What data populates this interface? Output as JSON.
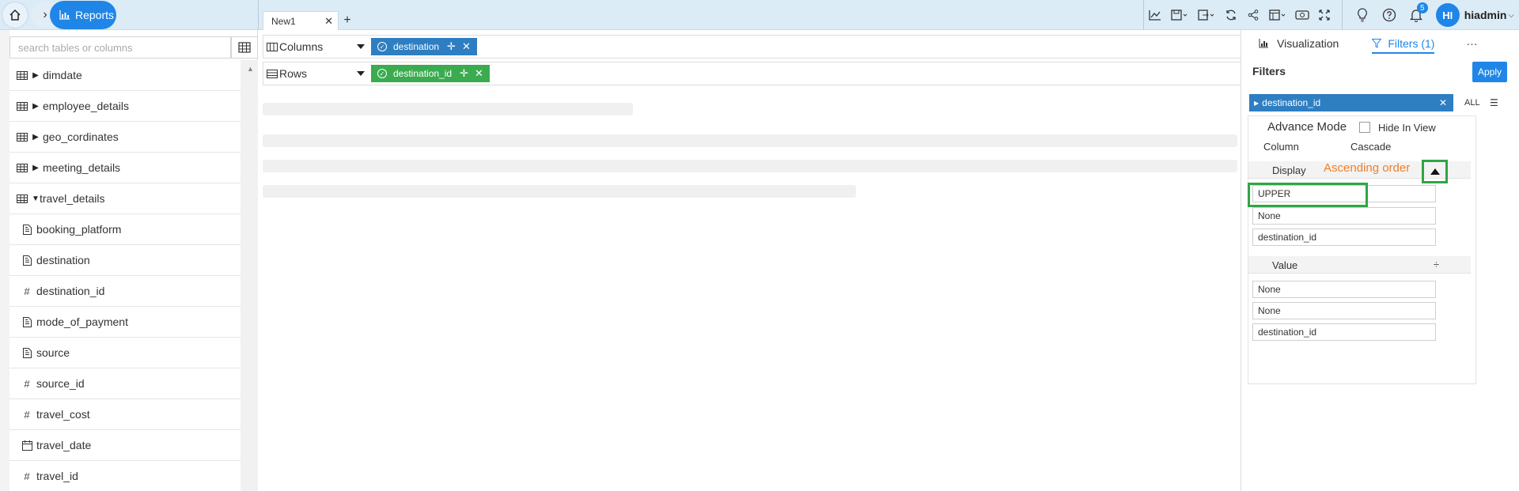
{
  "topbar": {
    "breadcrumb_label": "Reports",
    "tabs": [
      {
        "label": "New1"
      }
    ],
    "add_tab": "+",
    "notification_count": "5",
    "user": {
      "initials": "HI",
      "name": "hiadmin"
    }
  },
  "left": {
    "search_placeholder": "search tables or columns",
    "items": [
      {
        "type": "table",
        "label": "dimdate",
        "expanded": false
      },
      {
        "type": "table",
        "label": "employee_details",
        "expanded": false
      },
      {
        "type": "table",
        "label": "geo_cordinates",
        "expanded": false
      },
      {
        "type": "table",
        "label": "meeting_details",
        "expanded": false
      },
      {
        "type": "table",
        "label": "travel_details",
        "expanded": true
      },
      {
        "type": "text",
        "label": "booking_platform"
      },
      {
        "type": "text",
        "label": "destination"
      },
      {
        "type": "number",
        "label": "destination_id"
      },
      {
        "type": "text",
        "label": "mode_of_payment"
      },
      {
        "type": "text",
        "label": "source"
      },
      {
        "type": "number",
        "label": "source_id"
      },
      {
        "type": "number",
        "label": "travel_cost"
      },
      {
        "type": "date",
        "label": "travel_date"
      },
      {
        "type": "number",
        "label": "travel_id"
      }
    ]
  },
  "shelves": {
    "columns_label": "Columns",
    "columns_chip": "destination",
    "rows_label": "Rows",
    "rows_chip": "destination_id"
  },
  "right": {
    "tab_visualization": "Visualization",
    "tab_filters": "Filters (1)",
    "more": "···",
    "filters_title": "Filters",
    "apply": "Apply",
    "filter_chip": "destination_id",
    "all_label": "ALL",
    "advance_mode": "Advance Mode",
    "hide_in_view": "Hide In View",
    "column_label": "Column",
    "cascade_label": "Cascade",
    "display_section": "Display",
    "display_fields": [
      "UPPER",
      "None",
      "destination_id"
    ],
    "value_section": "Value",
    "value_fields": [
      "None",
      "None",
      "destination_id"
    ],
    "annotation": "Ascending order"
  },
  "colors": {
    "accent": "#1f86e8",
    "chip_blue": "#2e7ec2",
    "chip_green": "#3bab4f",
    "highlight": "#2ea643",
    "annotation": "#f07e26"
  }
}
